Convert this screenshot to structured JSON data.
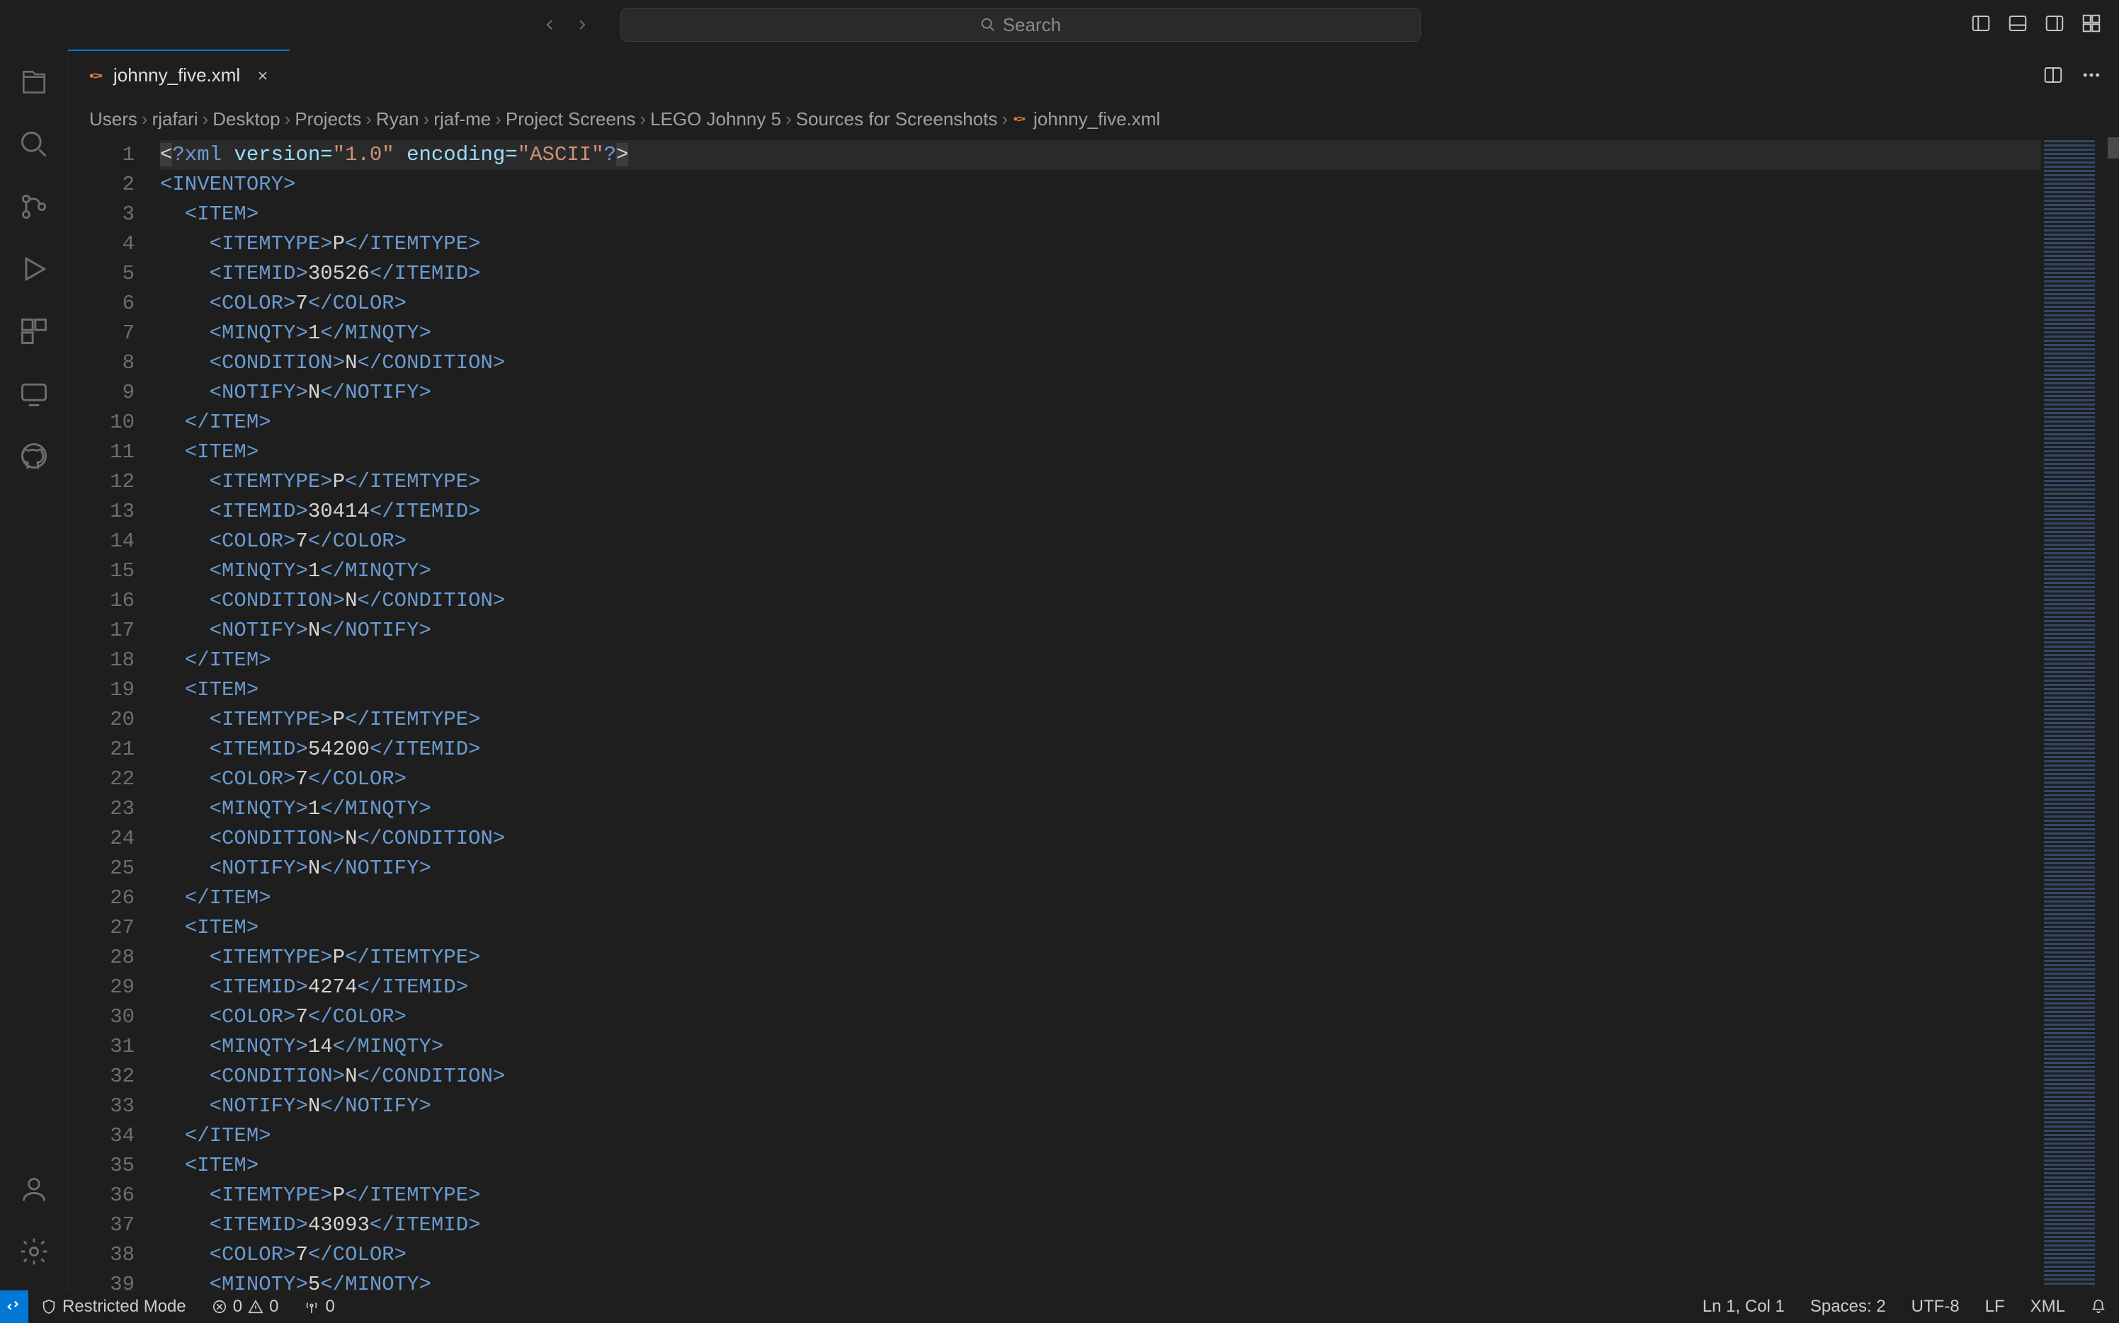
{
  "search": {
    "placeholder": "Search"
  },
  "tabs": [
    {
      "label": "johnny_five.xml"
    }
  ],
  "breadcrumbs": [
    "Users",
    "rjafari",
    "Desktop",
    "Projects",
    "Ryan",
    "rjaf-me",
    "Project Screens",
    "LEGO Johnny 5",
    "Sources for Screenshots",
    "johnny_five.xml"
  ],
  "editor": {
    "xml_declaration": {
      "version": "1.0",
      "encoding": "ASCII"
    },
    "root_tag": "INVENTORY",
    "item_tag": "ITEM",
    "items": [
      {
        "ITEMTYPE": "P",
        "ITEMID": "30526",
        "COLOR": "7",
        "MINQTY": "1",
        "CONDITION": "N",
        "NOTIFY": "N"
      },
      {
        "ITEMTYPE": "P",
        "ITEMID": "30414",
        "COLOR": "7",
        "MINQTY": "1",
        "CONDITION": "N",
        "NOTIFY": "N"
      },
      {
        "ITEMTYPE": "P",
        "ITEMID": "54200",
        "COLOR": "7",
        "MINQTY": "1",
        "CONDITION": "N",
        "NOTIFY": "N"
      },
      {
        "ITEMTYPE": "P",
        "ITEMID": "4274",
        "COLOR": "7",
        "MINQTY": "14",
        "CONDITION": "N",
        "NOTIFY": "N"
      },
      {
        "ITEMTYPE": "P",
        "ITEMID": "43093",
        "COLOR": "7",
        "MINQTY": "5"
      }
    ],
    "line_total": 39
  },
  "statusbar": {
    "restricted": "Restricted Mode",
    "errors": "0",
    "warnings": "0",
    "ports": "0",
    "cursor": "Ln 1, Col 1",
    "spaces": "Spaces: 2",
    "encoding": "UTF-8",
    "eol": "LF",
    "language": "XML"
  }
}
